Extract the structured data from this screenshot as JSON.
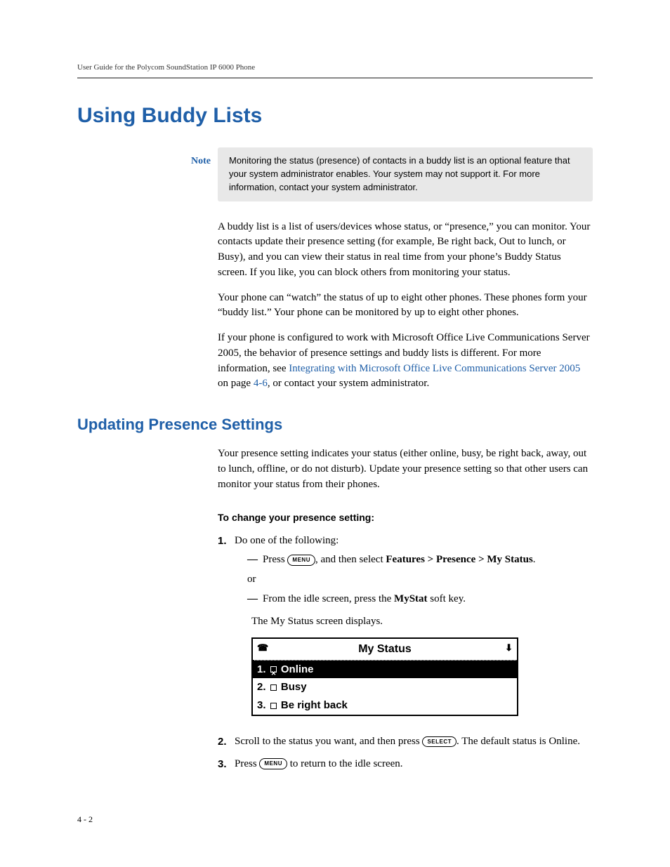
{
  "running_header": "User Guide for the Polycom SoundStation IP 6000 Phone",
  "h1": "Using Buddy Lists",
  "note": {
    "label": "Note",
    "text": "Monitoring the status (presence) of contacts in a buddy list is an optional feature that your system administrator enables. Your system may not support it. For more information, contact your system administrator."
  },
  "intro": {
    "p1": "A buddy list is a list of users/devices whose status, or “presence,” you can monitor. Your contacts update their presence setting (for example, Be right back, Out to lunch, or Busy), and you can view their status in real time from your phone’s Buddy Status screen. If you like, you can block others from monitoring your status.",
    "p2": "Your phone can “watch” the status of up to eight other phones. These phones form your “buddy list.” Your phone can be monitored by up to eight other phones.",
    "p3a": "If your phone is configured to work with Microsoft Office Live Communications Server 2005, the behavior of presence settings and buddy lists is different. For more information, see ",
    "p3link": "Integrating with Microsoft Office Live Communications Server 2005",
    "p3b": " on page ",
    "p3page": "4-6",
    "p3c": ", or contact your system administrator."
  },
  "h2": "Updating Presence Settings",
  "presence_intro": "Your presence setting indicates your status (either online, busy, be right back, away, out to lunch, offline, or do not disturb). Update your presence setting so that other users can monitor your status from their phones.",
  "procedure_heading": "To change your presence setting:",
  "steps": {
    "s1": {
      "num": "1.",
      "lead": "Do one of the following:",
      "opt1_a": "Press ",
      "btn_menu": "MENU",
      "opt1_b": ", and then select ",
      "opt1_strong": "Features > Presence > My Status",
      "opt1_c": ".",
      "or": "or",
      "opt2_a": "From the idle screen, press the ",
      "opt2_strong": "MyStat",
      "opt2_b": " soft key.",
      "after": "The My Status screen displays."
    },
    "s2": {
      "num": "2.",
      "a": "Scroll to the status you want, and then press ",
      "btn_select": "SELECT",
      "b": ". The default status is Online."
    },
    "s3": {
      "num": "3.",
      "a": "Press ",
      "btn_menu": "MENU",
      "b": " to return to the idle screen."
    }
  },
  "screen": {
    "title": "My Status",
    "rows": [
      {
        "n": "1.",
        "label": "Online",
        "selected": true
      },
      {
        "n": "2.",
        "label": "Busy",
        "selected": false
      },
      {
        "n": "3.",
        "label": "Be right back",
        "selected": false
      }
    ]
  },
  "page_number": "4 - 2"
}
